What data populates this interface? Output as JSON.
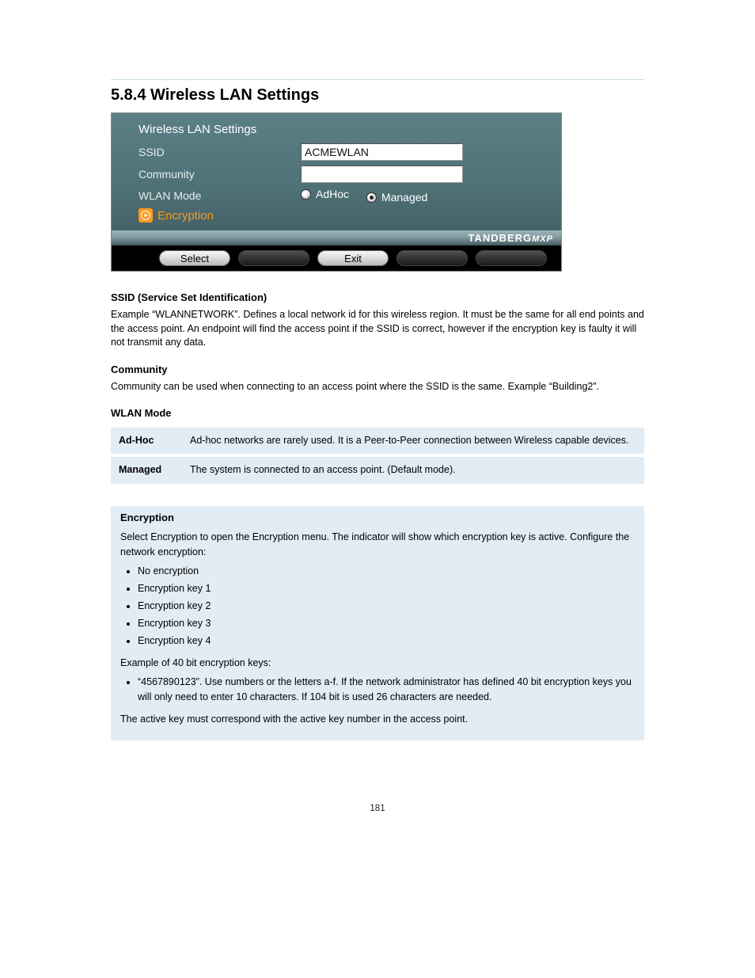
{
  "section_title": "5.8.4 Wireless LAN Settings",
  "device": {
    "title": "Wireless LAN Settings",
    "rows": {
      "ssid_label": "SSID",
      "ssid_value": "ACMEWLAN",
      "community_label": "Community",
      "community_value": "",
      "mode_label": "WLAN Mode",
      "mode_adhoc": "AdHoc",
      "mode_managed": "Managed",
      "encryption_label": "Encryption"
    },
    "brand_main": "TANDBERG",
    "brand_sub": "MXP",
    "buttons": {
      "select": "Select",
      "exit": "Exit"
    }
  },
  "ssid_section": {
    "heading": "SSID (Service Set Identification)",
    "text": "Example “WLANNETWORK”. Defines a local network id for this wireless region. It must be the same for all end points and the access point. An endpoint will find the access point if the SSID is correct, however if the encryption key is faulty it will not transmit any data."
  },
  "community_section": {
    "heading": "Community",
    "text": "Community can be used when connecting to an access point where the SSID is the same. Example “Building2”."
  },
  "mode_section": {
    "heading": "WLAN Mode",
    "rows": [
      {
        "name": "Ad-Hoc",
        "desc": "Ad-hoc networks are rarely used. It is a Peer-to-Peer connection between Wireless capable devices."
      },
      {
        "name": "Managed",
        "desc": "The system is connected to an access point. (Default mode)."
      }
    ]
  },
  "encryption_section": {
    "heading": "Encryption",
    "intro": "Select Encryption to open the Encryption menu. The indicator will show which encryption key is active. Configure the network encryption:",
    "bullets": [
      "No encryption",
      "Encryption key 1",
      "Encryption key 2",
      "Encryption key 3",
      "Encryption key 4"
    ],
    "note_lead": "Example of 40 bit encryption keys:",
    "note_item": "“4567890123”. Use numbers or the letters a-f. If the network administrator has defined 40 bit encryption keys you will only need to enter 10 characters. If 104 bit is used 26 characters are needed.",
    "footer": "The active key must correspond with the active key number in the access point."
  },
  "page_number": "181"
}
